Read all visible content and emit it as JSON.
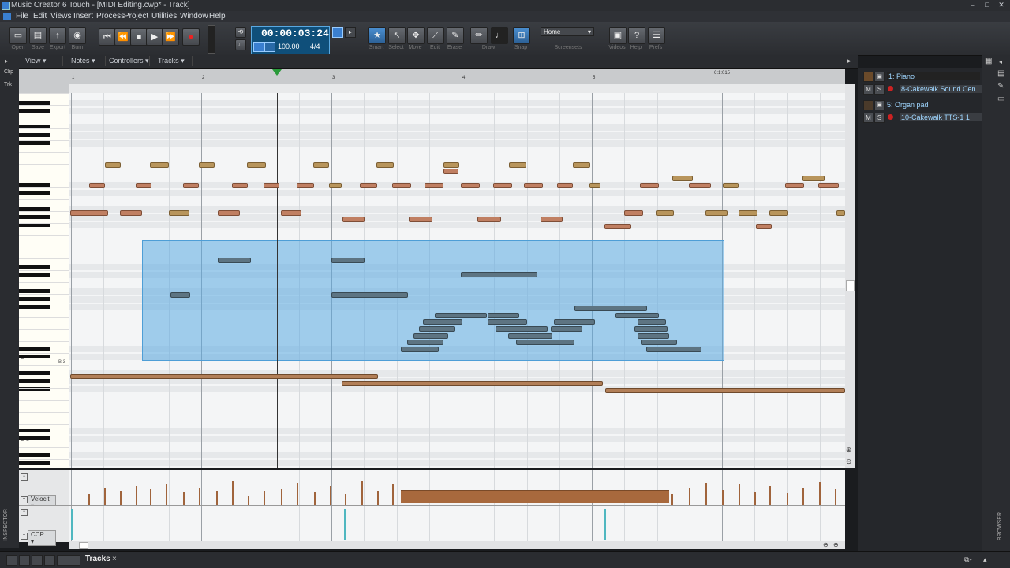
{
  "window": {
    "title": "Music Creator 6 Touch - [MIDI Editing.cwp* - Track]",
    "minimize": "–",
    "maximize": "□",
    "close": "✕"
  },
  "menu": [
    "File",
    "Edit",
    "Views",
    "Insert",
    "Process",
    "Project",
    "Utilities",
    "Window",
    "Help"
  ],
  "toolbar": {
    "file_buttons": [
      "Open",
      "Save",
      "Export",
      "Burn"
    ],
    "tool_labels": [
      "Smart",
      "Select",
      "Move",
      "Edit",
      "Erase",
      "Draw",
      "Snap"
    ],
    "screenset_label": "Screensets",
    "screenset_value": "Home",
    "right_labels": [
      "Videos",
      "Help",
      "Prefs"
    ]
  },
  "transport": {
    "time": "00:00:03:24",
    "tempo": "100.00",
    "meter": "4/4"
  },
  "pianoroll": {
    "menu": [
      "View",
      "Notes",
      "Controllers",
      "Tracks"
    ],
    "left_tabs": [
      "Clip",
      "Trk"
    ],
    "ruler": [
      "1",
      "2",
      "3",
      "4",
      "5",
      "6:1:015"
    ],
    "keys": [
      "C 7",
      "C 6",
      "C 5",
      "C 4",
      "C 3"
    ],
    "key_marker": "B 3",
    "velocity_lane": {
      "label": "Velocit",
      "max": "127",
      "mid": "64",
      "min": "0"
    },
    "cc_lane": {
      "label": "CCP...",
      "max": "127",
      "mid": "64",
      "min": "0"
    }
  },
  "tracks": [
    {
      "number_name": "1: Piano",
      "output": "8-Cakewalk Sound Cen...",
      "mute": "M",
      "solo": "S"
    },
    {
      "number_name": "5: Organ pad",
      "output": "10-Cakewalk TTS-1 1",
      "mute": "M",
      "solo": "S"
    }
  ],
  "bottom": {
    "tab": "Tracks",
    "close": "×",
    "inspector": "INSPECTOR",
    "browser": "BROWSER"
  },
  "colors": {
    "selection": "#5aaae1",
    "note_gold": "#b8955c",
    "note_blue": "#5d7482",
    "accent": "#3a7fd0"
  }
}
